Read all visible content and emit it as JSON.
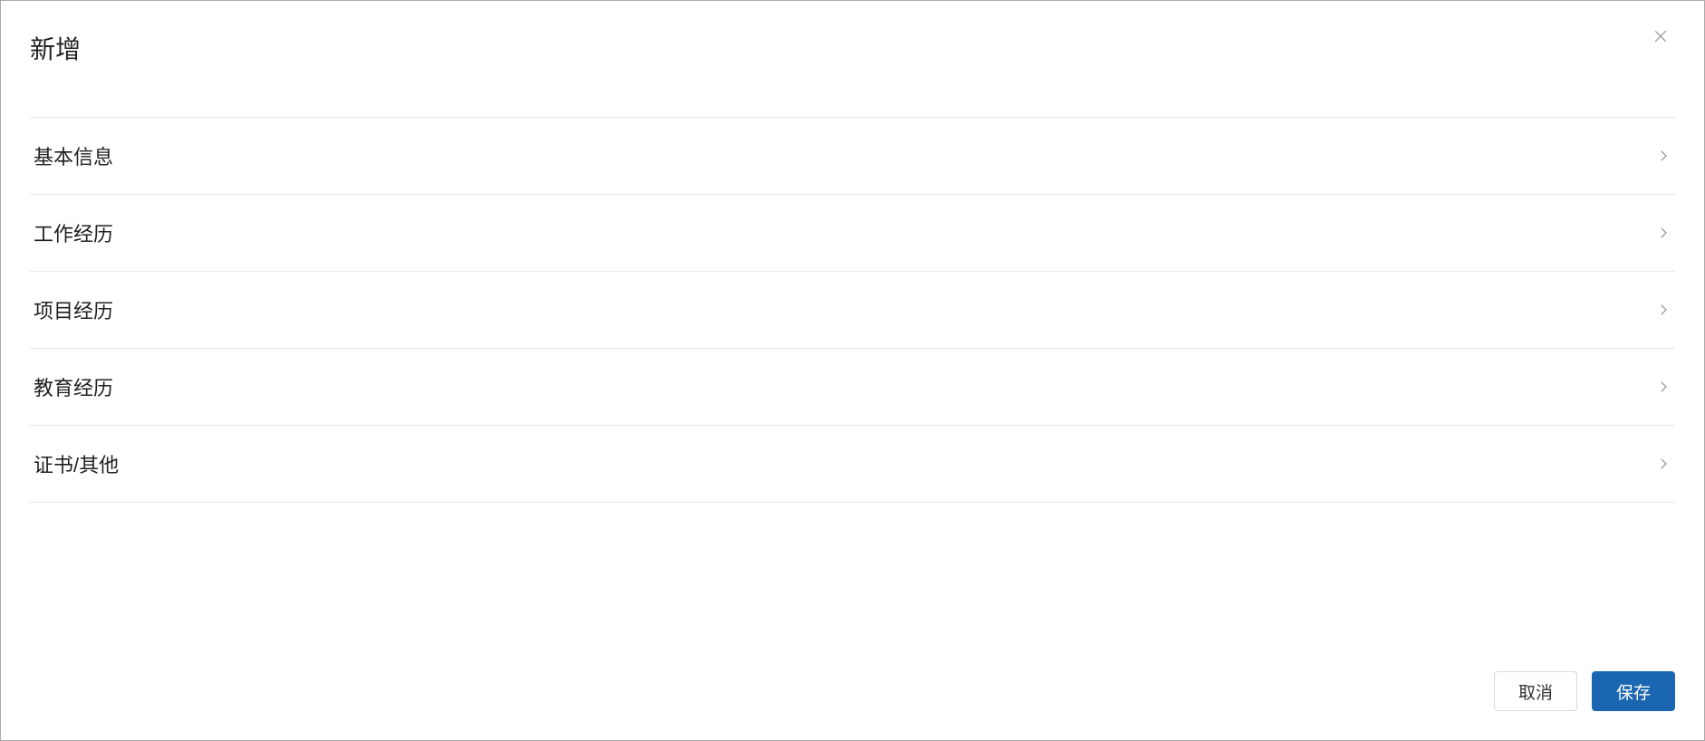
{
  "modal": {
    "title": "新增",
    "sections": [
      {
        "label": "基本信息"
      },
      {
        "label": "工作经历"
      },
      {
        "label": "项目经历"
      },
      {
        "label": "教育经历"
      },
      {
        "label": "证书/其他"
      }
    ],
    "footer": {
      "cancel_label": "取消",
      "save_label": "保存"
    }
  }
}
